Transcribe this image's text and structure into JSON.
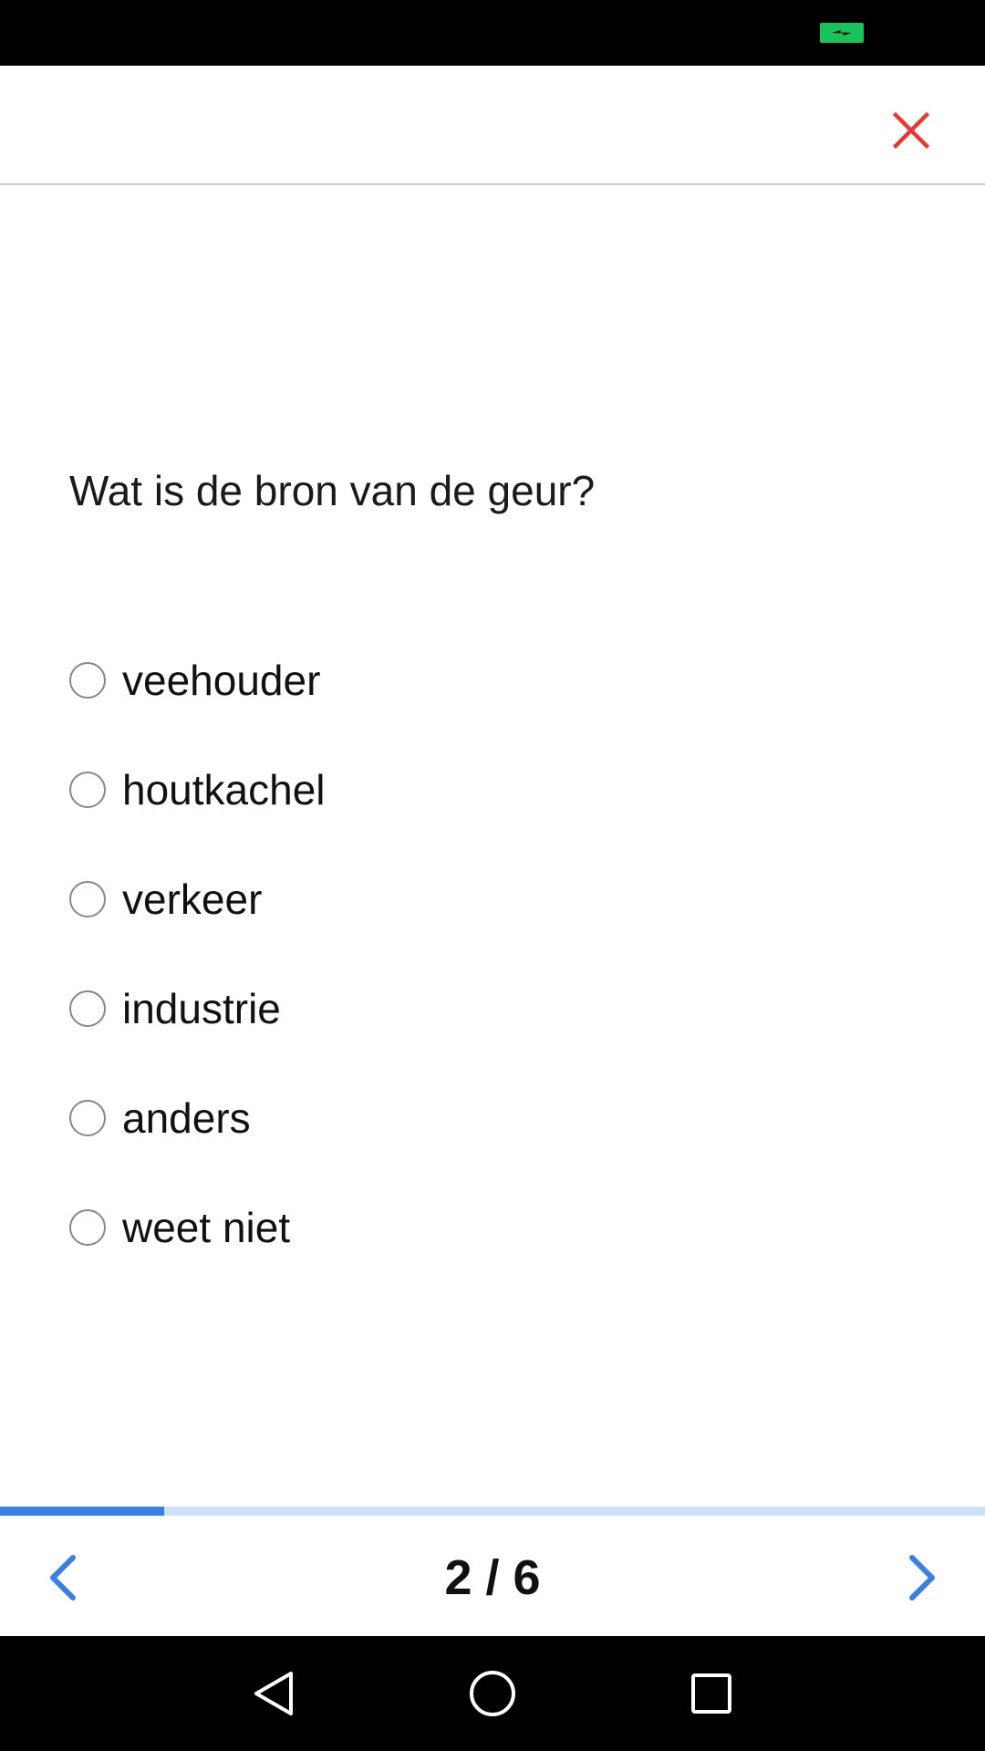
{
  "colors": {
    "accent": "#3b7fe0",
    "close": "#e53935",
    "progress_track": "#cfe0fa",
    "battery": "#19c25a"
  },
  "question": "Wat is de bron van de geur?",
  "options": [
    {
      "label": "veehouder",
      "selected": false
    },
    {
      "label": "houtkachel",
      "selected": false
    },
    {
      "label": "verkeer",
      "selected": false
    },
    {
      "label": "industrie",
      "selected": false
    },
    {
      "label": "anders",
      "selected": false
    },
    {
      "label": "weet niet",
      "selected": false
    }
  ],
  "pagination": {
    "text": "2 / 6",
    "current": 2,
    "total": 6
  },
  "progress": {
    "fraction": 0.167
  },
  "icons": {
    "close": "close-icon",
    "prev": "chevron-left-icon",
    "next": "chevron-right-icon",
    "battery": "battery-charging-icon",
    "back": "back-triangle-icon",
    "home": "home-circle-icon",
    "recents": "recents-square-icon"
  }
}
